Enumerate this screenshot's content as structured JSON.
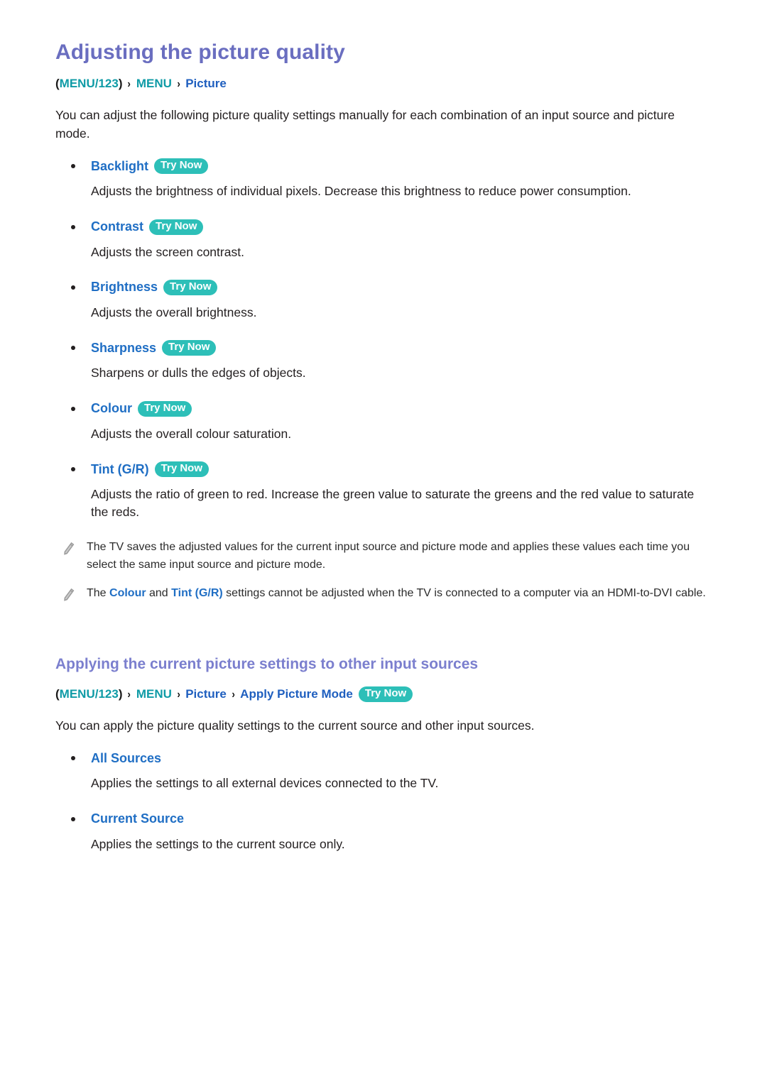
{
  "document": {
    "title": "Adjusting the picture quality",
    "breadcrumb_1": {
      "open_paren": "(",
      "menu123": "MENU/123",
      "close_paren": ")",
      "sep": "›",
      "menu": "MENU",
      "picture": "Picture"
    },
    "intro": "You can adjust the following picture quality settings manually for each combination of an input source and picture mode.",
    "settings": [
      {
        "label": "Backlight",
        "badge": "Try Now",
        "description": "Adjusts the brightness of individual pixels. Decrease this brightness to reduce power consumption."
      },
      {
        "label": "Contrast",
        "badge": "Try Now",
        "description": "Adjusts the screen contrast."
      },
      {
        "label": "Brightness",
        "badge": "Try Now",
        "description": "Adjusts the overall brightness."
      },
      {
        "label": "Sharpness",
        "badge": "Try Now",
        "description": "Sharpens or dulls the edges of objects."
      },
      {
        "label": "Colour",
        "badge": "Try Now",
        "description": "Adjusts the overall colour saturation."
      },
      {
        "label": "Tint (G/R)",
        "badge": "Try Now",
        "description": "Adjusts the ratio of green to red. Increase the green value to saturate the greens and the red value to saturate the reds."
      }
    ],
    "notes": [
      {
        "icon": "pencil-icon",
        "text": "The TV saves the adjusted values for the current input source and picture mode and applies these values each time you select the same input source and picture mode."
      },
      {
        "icon": "pencil-icon",
        "text_part_1": "The ",
        "highlight_1": "Colour",
        "text_part_2": " and ",
        "highlight_2": "Tint (G/R)",
        "text_part_3": " settings cannot be adjusted when the TV is connected to a computer via an HDMI-to-DVI cable."
      }
    ],
    "section_2": {
      "title": "Applying the current picture settings to other input sources",
      "breadcrumb": {
        "open_paren": "(",
        "menu123": "MENU/123",
        "close_paren": ")",
        "sep": "›",
        "menu": "MENU",
        "picture": "Picture",
        "apply_picture_mode": "Apply Picture Mode",
        "badge": "Try Now"
      },
      "intro": "You can apply the picture quality settings to the current source and other input sources.",
      "options": [
        {
          "label": "All Sources",
          "description": "Applies the settings to all external devices connected to the TV."
        },
        {
          "label": "Current Source",
          "description": "Applies the settings to the current source only."
        }
      ]
    }
  },
  "colors": {
    "title_purple": "#6a6ec0",
    "section_purple": "#7b7fce",
    "breadcrumb_teal": "#0f9ba6",
    "breadcrumb_blue": "#1f5fbf",
    "item_blue": "#1f6ec4",
    "badge_teal": "#2dbfb8",
    "body_text": "#231f20"
  }
}
